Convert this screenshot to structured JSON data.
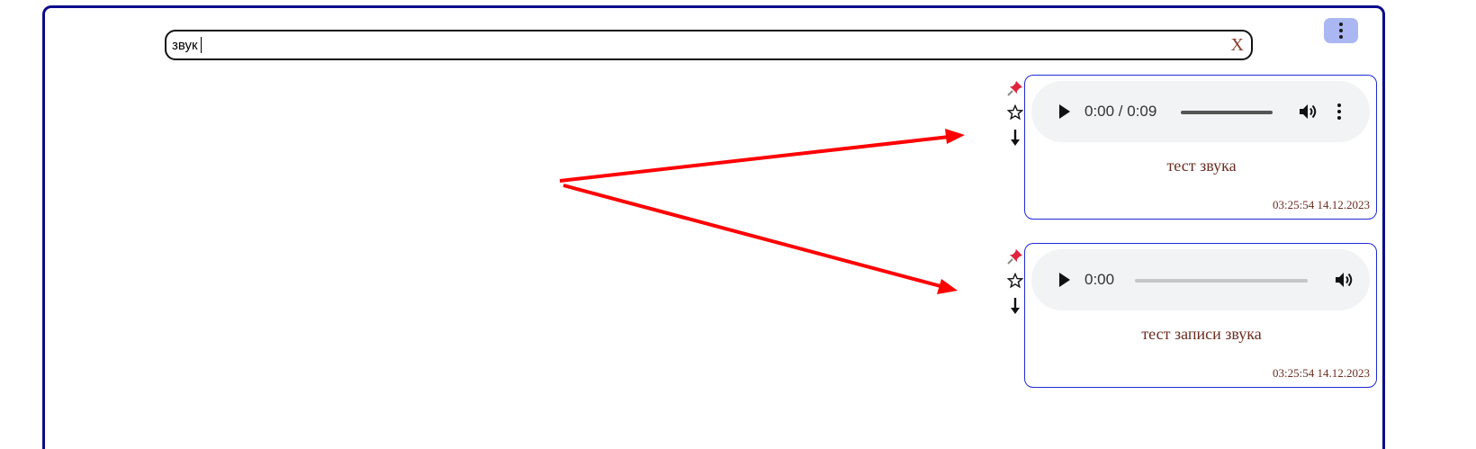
{
  "search": {
    "value": "звук",
    "clear_label": "X"
  },
  "menu": {
    "icon": "more-vertical-icon"
  },
  "colors": {
    "frame_border": "#0b0b8c",
    "menu_button_bg": "#aab7f2",
    "card_border": "#1f2bd6",
    "text_brown": "#6b2c20",
    "annotation_arrow": "#ff0000"
  },
  "records": [
    {
      "title": "тест звука",
      "timestamp": "03:25:54 14.12.2023",
      "player": {
        "time": "0:00 / 0:09",
        "progress": 0,
        "has_more_menu": true
      },
      "actions": [
        "pin-icon",
        "star-icon",
        "download-icon"
      ]
    },
    {
      "title": "тест записи звука",
      "timestamp": "03:25:54 14.12.2023",
      "player": {
        "time": "0:00",
        "progress": 0,
        "has_more_menu": false
      },
      "actions": [
        "pin-icon",
        "star-icon",
        "download-icon"
      ]
    }
  ]
}
